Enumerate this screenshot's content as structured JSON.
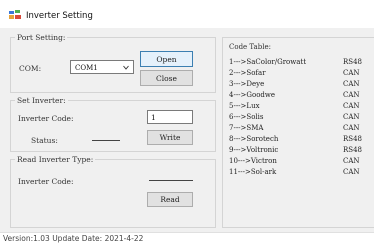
{
  "window": {
    "title": "Inverter Setting",
    "icon": "app-icon"
  },
  "port_setting": {
    "group_label": "Port Setting:",
    "com_label": "COM:",
    "com_value": "COM1",
    "open_label": "Open",
    "close_label": "Close"
  },
  "set_inverter": {
    "group_label": "Set Inverter:",
    "code_label": "Inverter Code:",
    "code_value": "1",
    "status_label": "Status:",
    "status_value": "",
    "write_label": "Write"
  },
  "read_inverter": {
    "group_label": "Read Inverter Type:",
    "code_label": "Inverter Code:",
    "code_value": "",
    "read_label": "Read"
  },
  "code_table": {
    "label": "Code Table:",
    "rows": [
      {
        "entry": "1--->SaColor/Growatt",
        "protocol": "RS48"
      },
      {
        "entry": "2--->Sofar",
        "protocol": "CAN"
      },
      {
        "entry": "3--->Deye",
        "protocol": "CAN"
      },
      {
        "entry": "4--->Goodwe",
        "protocol": "CAN"
      },
      {
        "entry": "5--->Lux",
        "protocol": "CAN"
      },
      {
        "entry": "6--->Solis",
        "protocol": "CAN"
      },
      {
        "entry": "7--->SMA",
        "protocol": "CAN"
      },
      {
        "entry": "8--->Sorotech",
        "protocol": "RS48"
      },
      {
        "entry": "9--->Voltronic",
        "protocol": "RS48"
      },
      {
        "entry": "10--->Victron",
        "protocol": "CAN"
      },
      {
        "entry": "11--->Sol-ark",
        "protocol": "CAN"
      }
    ]
  },
  "status_bar": {
    "text": "Version:1.03  Update Date:  2021-4-22"
  },
  "colors": {
    "window_bg": "#f0f0f0",
    "button_bg": "#e1e1e1",
    "focus_border": "#3c7fb1",
    "group_border": "#d4d4d4"
  }
}
